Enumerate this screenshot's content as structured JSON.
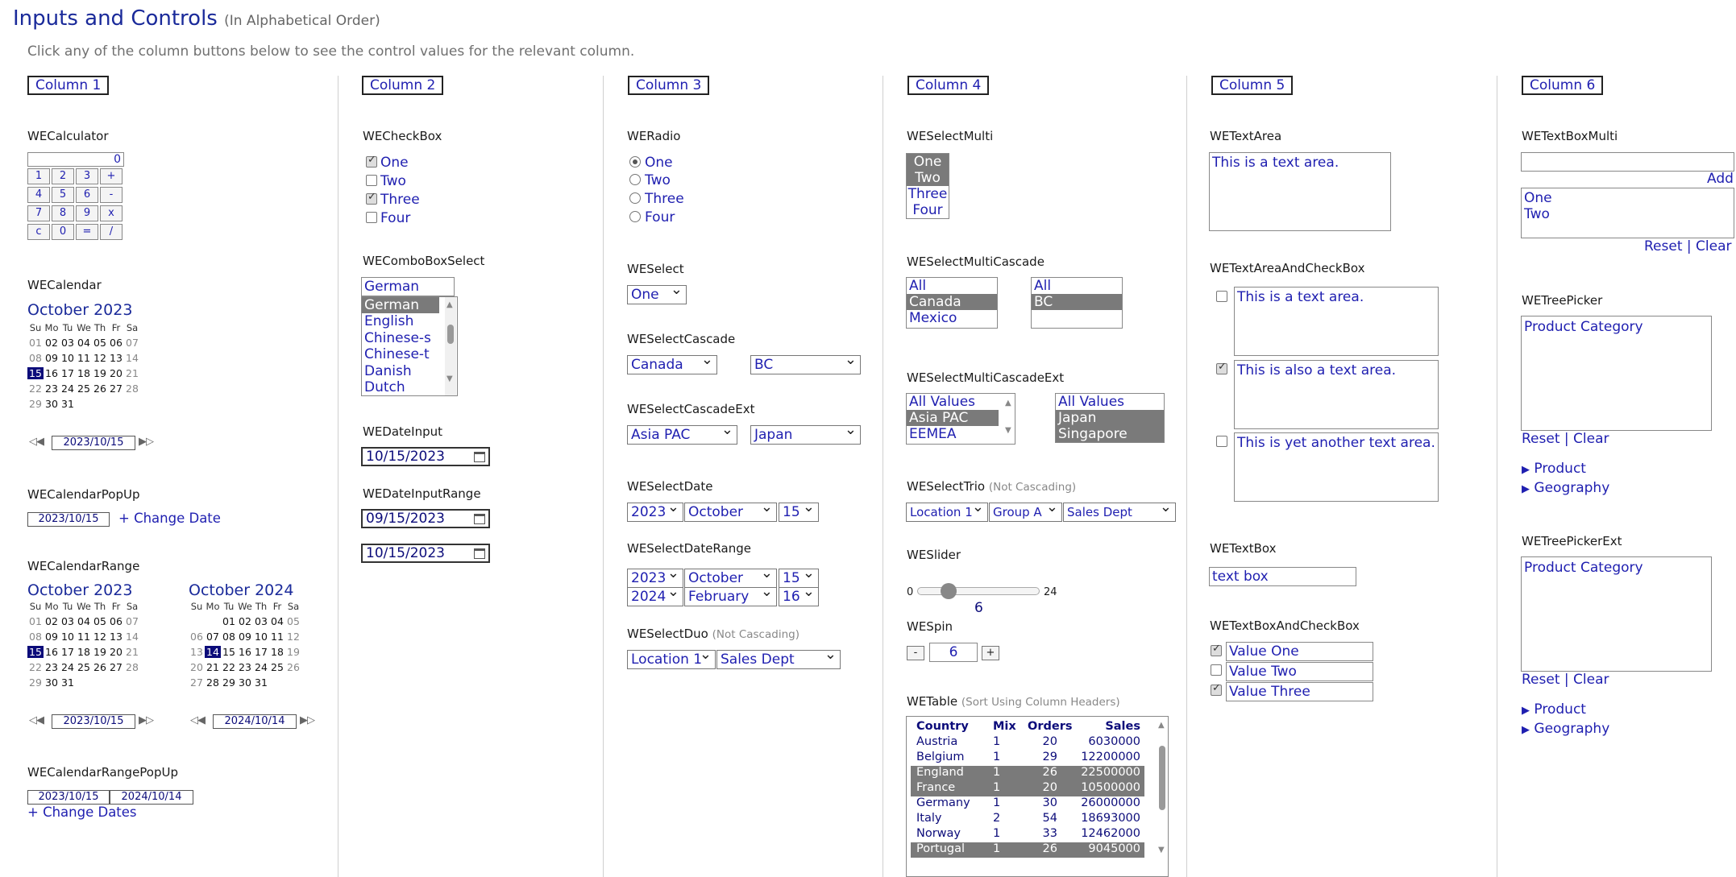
{
  "header": {
    "title": "Inputs and Controls",
    "title_note": "(In Alphabetical Order)",
    "instructions": "Click any of the column buttons below to see the control values for the relevant column."
  },
  "columns": [
    "Column 1",
    "Column 2",
    "Column 3",
    "Column 4",
    "Column 5",
    "Column 6"
  ],
  "col1": {
    "calculator": {
      "label": "WECalculator",
      "display": "0",
      "keys": [
        "1",
        "2",
        "3",
        "+",
        "4",
        "5",
        "6",
        "-",
        "7",
        "8",
        "9",
        "x",
        "c",
        "0",
        "=",
        "/"
      ]
    },
    "calendar": {
      "label": "WECalendar",
      "month": "October 2023",
      "dow": [
        "Su",
        "Mo",
        "Tu",
        "We",
        "Th",
        "Fr",
        "Sa"
      ],
      "date": "2023/10/15"
    },
    "calendar_popup": {
      "label": "WECalendarPopUp",
      "date": "2023/10/15",
      "link": "+ Change Date"
    },
    "calendar_range": {
      "label": "WECalendarRange",
      "month1": "October 2023",
      "month2": "October 2024",
      "date1": "2023/10/15",
      "date2": "2024/10/14"
    },
    "calendar_range_popup": {
      "label": "WECalendarRangePopUp",
      "date1": "2023/10/15",
      "date2": "2024/10/14",
      "link": "+ Change Dates"
    }
  },
  "col2": {
    "checkbox": {
      "label": "WECheckBox",
      "items": [
        "One",
        "Two",
        "Three",
        "Four"
      ]
    },
    "combo": {
      "label": "WEComboBoxSelect",
      "value": "German",
      "items": [
        "German",
        "English",
        "Chinese-s",
        "Chinese-t",
        "Danish",
        "Dutch"
      ]
    },
    "date_input": {
      "label": "WEDateInput",
      "value": "10/15/2023"
    },
    "date_input_range": {
      "label": "WEDateInputRange",
      "value1": "09/15/2023",
      "value2": "10/15/2023"
    }
  },
  "col3": {
    "radio": {
      "label": "WERadio",
      "items": [
        "One",
        "Two",
        "Three",
        "Four"
      ]
    },
    "select": {
      "label": "WESelect",
      "value": "One"
    },
    "select_cascade": {
      "label": "WESelectCascade",
      "value1": "Canada",
      "value2": "BC"
    },
    "select_cascade_ext": {
      "label": "WESelectCascadeExt",
      "value1": "Asia PAC",
      "value2": "Japan"
    },
    "select_date": {
      "label": "WESelectDate",
      "year": "2023",
      "month": "October",
      "day": "15"
    },
    "select_date_range": {
      "label": "WESelectDateRange",
      "year1": "2023",
      "month1": "October",
      "day1": "15",
      "year2": "2024",
      "month2": "February",
      "day2": "16"
    },
    "select_duo": {
      "label": "WESelectDuo",
      "note": "(Not Cascading)",
      "value1": "Location 1",
      "value2": "Sales Dept"
    }
  },
  "col4": {
    "select_multi": {
      "label": "WESelectMulti",
      "items": [
        "One",
        "Two",
        "Three",
        "Four"
      ]
    },
    "select_multi_cascade": {
      "label": "WESelectMultiCascade",
      "left": [
        "All",
        "Canada",
        "Mexico"
      ],
      "right": [
        "All",
        "BC"
      ]
    },
    "select_multi_cascade_ext": {
      "label": "WESelectMultiCascadeExt",
      "left": [
        "All Values",
        "Asia PAC",
        "EEMEA"
      ],
      "right": [
        "All Values",
        "Japan",
        "Singapore"
      ]
    },
    "select_trio": {
      "label": "WESelectTrio",
      "note": "(Not Cascading)",
      "value1": "Location 1",
      "value2": "Group A",
      "value3": "Sales Dept"
    },
    "slider": {
      "label": "WESlider",
      "min": "0",
      "max": "24",
      "value": "6",
      "fraction": 0.25
    },
    "spin": {
      "label": "WESpin",
      "minus": "-",
      "value": "6",
      "plus": "+"
    },
    "table": {
      "label": "WETable",
      "note": "(Sort Using Column Headers)",
      "headers": [
        "Country",
        "Mix",
        "Orders",
        "Sales"
      ],
      "rows": [
        [
          "Austria",
          "1",
          "20",
          "6030000"
        ],
        [
          "Belgium",
          "1",
          "29",
          "12200000"
        ],
        [
          "England",
          "1",
          "26",
          "22500000"
        ],
        [
          "France",
          "1",
          "20",
          "10500000"
        ],
        [
          "Germany",
          "1",
          "30",
          "26000000"
        ],
        [
          "Italy",
          "2",
          "54",
          "18693000"
        ],
        [
          "Norway",
          "1",
          "33",
          "12462000"
        ],
        [
          "Portugal",
          "1",
          "26",
          "9045000"
        ]
      ]
    }
  },
  "col5": {
    "textarea": {
      "label": "WETextArea",
      "value": "This is a text area."
    },
    "textarea_cb": {
      "label": "WETextAreaAndCheckBox",
      "values": [
        "This is a text area.",
        "This is also a text area.",
        "This is yet another text area."
      ]
    },
    "textbox": {
      "label": "WETextBox",
      "value": "text box"
    },
    "textbox_cb": {
      "label": "WETextBoxAndCheckBox",
      "values": [
        "Value One",
        "Value Two",
        "Value Three"
      ]
    }
  },
  "col6": {
    "textbox_multi": {
      "label": "WETextBoxMulti",
      "add": "Add",
      "items": [
        "One",
        "Two"
      ],
      "reset": "Reset",
      "sep": "|",
      "clear": "Clear"
    },
    "tree_picker": {
      "label": "WETreePicker",
      "placeholder": "Product Category",
      "reset": "Reset",
      "sep": "|",
      "clear": "Clear",
      "nodes": [
        "Product",
        "Geography"
      ]
    },
    "tree_picker_ext": {
      "label": "WETreePickerExt",
      "placeholder": "Product Category",
      "reset": "Reset",
      "sep": "|",
      "clear": "Clear",
      "nodes": [
        "Product",
        "Geography"
      ]
    }
  }
}
